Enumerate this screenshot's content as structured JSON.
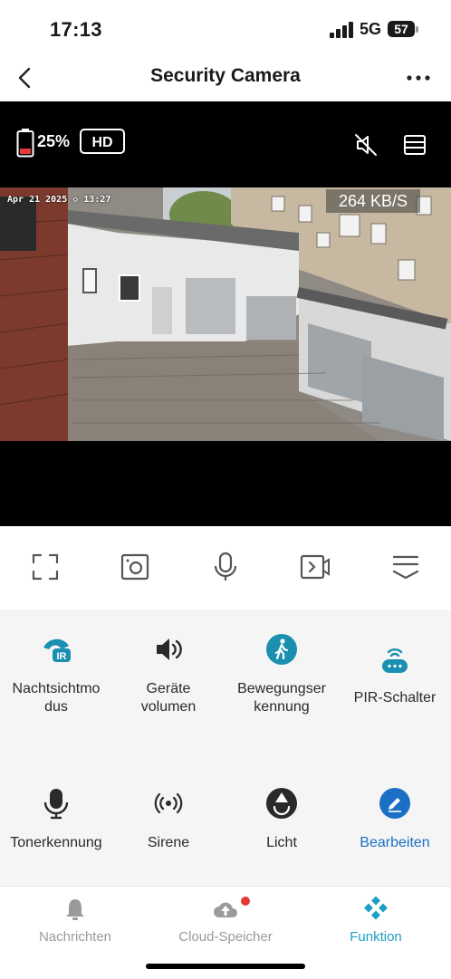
{
  "status_bar": {
    "time": "17:13",
    "network": "5G",
    "battery": "57"
  },
  "header": {
    "title": "Security Camera"
  },
  "video": {
    "battery_percent": "25%",
    "quality": "HD",
    "osd_timestamp": "Apr 21 2025  ◇ 13:27",
    "bitrate": "264 KB/S"
  },
  "toolbar": {
    "items": [
      {
        "icon": "fullscreen-icon"
      },
      {
        "icon": "screenshot-icon"
      },
      {
        "icon": "microphone-icon"
      },
      {
        "icon": "record-video-icon"
      },
      {
        "icon": "collapse-icon"
      }
    ]
  },
  "functions": {
    "items": [
      {
        "label": "Nachtsichtmo\ndus",
        "icon": "night-vision-icon"
      },
      {
        "label": "Geräte\nvolumen",
        "icon": "speaker-icon"
      },
      {
        "label": "Bewegungser\nkennung",
        "icon": "motion-detection-icon"
      },
      {
        "label": "PIR-Schalter",
        "icon": "pir-sensor-icon"
      },
      {
        "label": "Tonerkennung",
        "icon": "microphone-icon"
      },
      {
        "label": "Sirene",
        "icon": "siren-icon"
      },
      {
        "label": "Licht",
        "icon": "light-icon"
      },
      {
        "label": "Bearbeiten",
        "icon": "edit-icon"
      }
    ]
  },
  "tabs": {
    "items": [
      {
        "label": "Nachrichten",
        "icon": "bell-icon"
      },
      {
        "label": "Cloud-Speicher",
        "icon": "cloud-upload-icon"
      },
      {
        "label": "Funktion",
        "icon": "function-icon",
        "active": true
      }
    ]
  },
  "colors": {
    "accent": "#1a8fb0",
    "active_tab": "#1e9ec4",
    "notification": "#e53935",
    "edit": "#1b6fc4"
  }
}
